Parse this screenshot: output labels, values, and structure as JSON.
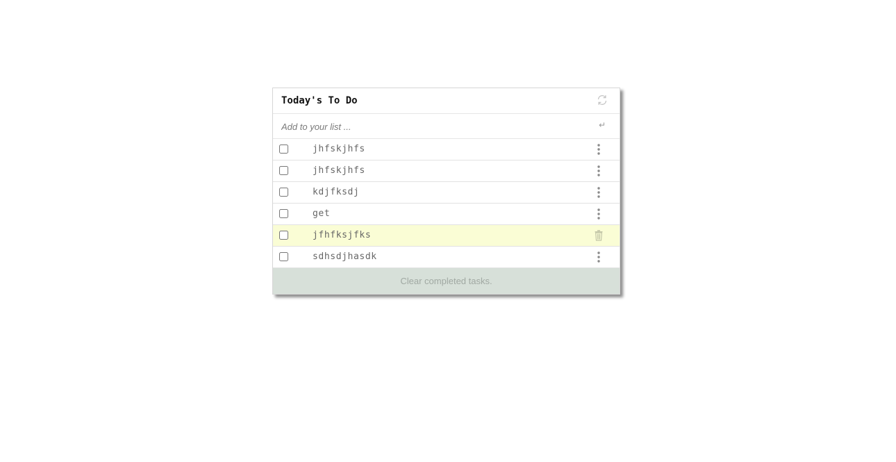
{
  "header": {
    "title": "Today's To Do",
    "refresh_icon": "refresh-icon"
  },
  "add": {
    "placeholder": "Add to your list ...",
    "enter_icon": "↵"
  },
  "tasks": [
    {
      "text": "jhfskjhfs",
      "checked": false,
      "action_icon": "kebab-menu-icon"
    },
    {
      "text": "jhfskjhfs",
      "checked": false,
      "action_icon": "kebab-menu-icon"
    },
    {
      "text": "kdjfksdj",
      "checked": false,
      "action_icon": "kebab-menu-icon"
    },
    {
      "text": "get",
      "checked": false,
      "action_icon": "kebab-menu-icon"
    },
    {
      "text": "jfhfksjfks",
      "checked": false,
      "action_icon": "trash-icon",
      "highlighted": true
    },
    {
      "text": "sdhsdjhasdk",
      "checked": false,
      "action_icon": "kebab-menu-icon"
    }
  ],
  "footer": {
    "clear_label": "Clear completed tasks."
  },
  "colors": {
    "highlight_row": "#fafdd5",
    "footer_bg": "#d7e0d9"
  }
}
